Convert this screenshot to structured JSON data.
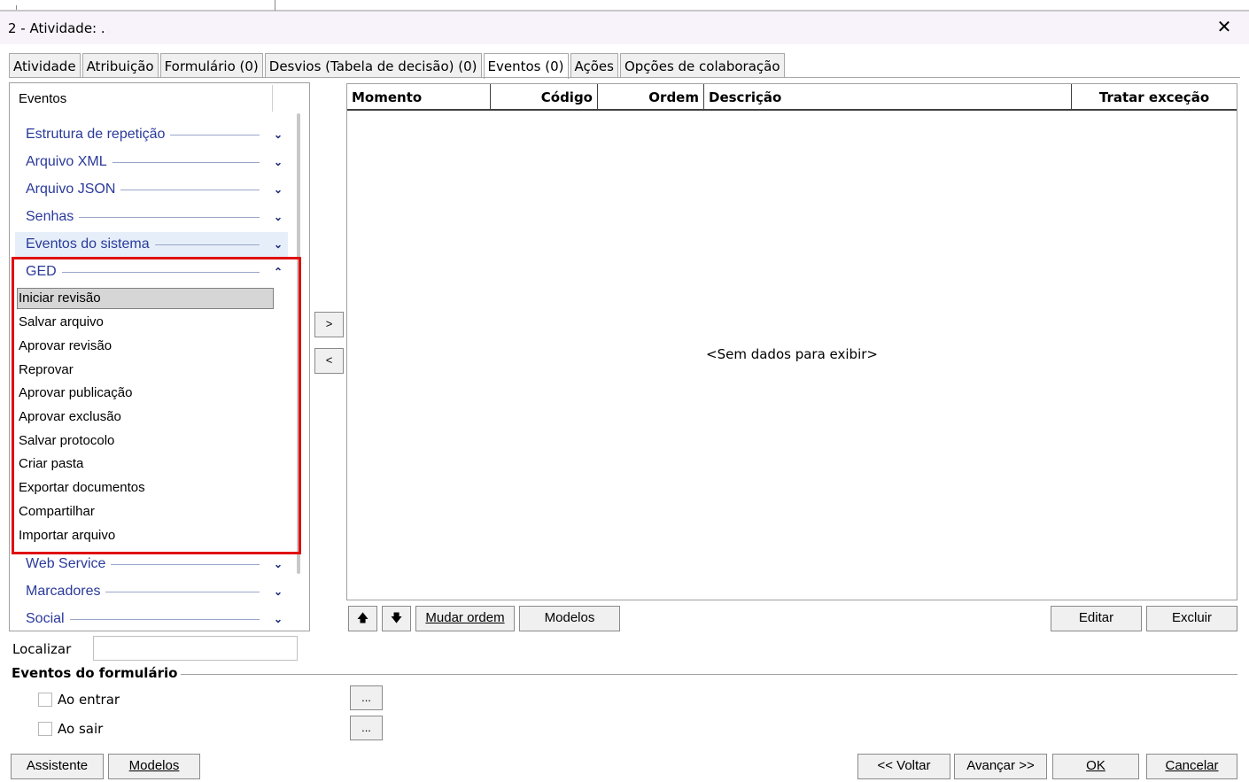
{
  "window": {
    "title": "2 - Atividade: .",
    "close_label": "✕"
  },
  "tabs": [
    {
      "label": "Atividade"
    },
    {
      "label": "Atribuição"
    },
    {
      "label": "Formulário (0)"
    },
    {
      "label": "Desvios (Tabela de decisão) (0)"
    },
    {
      "label": "Eventos (0)",
      "active": true
    },
    {
      "label": "Ações"
    },
    {
      "label": "Opções de colaboração"
    }
  ],
  "left_panel": {
    "header": "Eventos",
    "groups_top": [
      {
        "label": "Estrutura de repetição",
        "icon": "chevron-down-icon"
      },
      {
        "label": "Arquivo XML",
        "icon": "chevron-down-icon"
      },
      {
        "label": "Arquivo JSON",
        "icon": "chevron-down-icon"
      },
      {
        "label": "Senhas",
        "icon": "chevron-down-icon"
      },
      {
        "label": "Eventos do sistema",
        "icon": "chevron-down-icon"
      }
    ],
    "ged_group": {
      "label": "GED",
      "icon": "chevron-up-icon",
      "items": [
        "Iniciar revisão",
        "Salvar arquivo",
        "Aprovar revisão",
        "Reprovar",
        "Aprovar publicação",
        "Aprovar exclusão",
        "Salvar protocolo",
        "Criar pasta",
        "Exportar documentos",
        "Compartilhar",
        "Importar arquivo"
      ],
      "selected_index": 0
    },
    "groups_bottom": [
      {
        "label": "Web Service",
        "icon": "chevron-down-icon"
      },
      {
        "label": "Marcadores",
        "icon": "chevron-down-icon"
      },
      {
        "label": "Social",
        "icon": "chevron-down-icon"
      }
    ]
  },
  "transfer": {
    "add_label": ">",
    "remove_label": "<"
  },
  "grid": {
    "columns": [
      "Momento",
      "Código",
      "Ordem",
      "Descrição",
      "Tratar exceção"
    ],
    "empty_message": "<Sem dados para exibir>"
  },
  "grid_toolbar": {
    "up_label": "🡅",
    "down_label": "🡇",
    "mudar_ordem": "Mudar ordem",
    "modelos": "Modelos",
    "editar": "Editar",
    "excluir": "Excluir"
  },
  "search": {
    "label": "Localizar",
    "value": ""
  },
  "form_events": {
    "title": "Eventos do formulário",
    "items": [
      {
        "label": "Ao entrar",
        "checked": false,
        "button": "..."
      },
      {
        "label": "Ao sair",
        "checked": false,
        "button": "..."
      }
    ]
  },
  "footer": {
    "assistente": "Assistente",
    "modelos": "Modelos",
    "voltar": "<< Voltar",
    "avancar": "Avançar >>",
    "ok": "OK",
    "cancelar": "Cancelar"
  },
  "colors": {
    "highlight": "#e01010",
    "group_text": "#2a3a9a",
    "title_bg": "#f8f3fa"
  }
}
